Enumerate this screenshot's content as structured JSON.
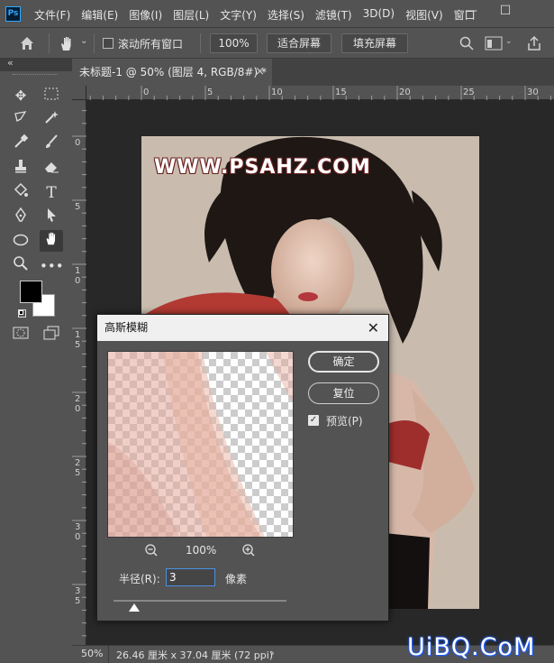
{
  "app": {
    "logo_text": "Ps"
  },
  "menu": [
    "文件(F)",
    "编辑(E)",
    "图像(I)",
    "图层(L)",
    "文字(Y)",
    "选择(S)",
    "滤镜(T)",
    "3D(D)",
    "视图(V)",
    "窗口"
  ],
  "window_controls": {
    "minimize": "—",
    "maximize": "☐"
  },
  "options": {
    "scroll_all_label": "滚动所有窗口",
    "zoom_value": "100%",
    "fit_screen": "适合屏幕",
    "fill_screen": "填充屏幕"
  },
  "toolbox": {
    "collapse": "«"
  },
  "document": {
    "tab_title": "未标题-1 @ 50% (图层 4, RGB/8#) *",
    "tab_close": "×"
  },
  "rulers": {
    "h": [
      "0",
      "5",
      "10",
      "15",
      "20",
      "25",
      "30"
    ],
    "v": [
      [
        "0"
      ],
      [
        "5"
      ],
      [
        "1",
        "0"
      ],
      [
        "1",
        "5"
      ],
      [
        "2",
        "0"
      ],
      [
        "2",
        "5"
      ],
      [
        "3",
        "0"
      ],
      [
        "3",
        "5"
      ]
    ]
  },
  "image_text": "WWW.PSAHZ.COM",
  "dialog": {
    "title": "高斯模糊",
    "close": "✕",
    "ok": "确定",
    "reset": "复位",
    "preview_label": "预览(P)",
    "preview_checked": true,
    "zoom_out": "⊖",
    "zoom_in": "⊕",
    "zoom_level": "100%",
    "radius_label": "半径(R):",
    "radius_value": "3",
    "radius_unit": "像素",
    "radius_slider_fraction": 0.12
  },
  "status": {
    "zoom": "50%",
    "doc_info": "26.46 厘米 x 37.04 厘米 (72 ppi)",
    "arrow": "›"
  },
  "watermark": "UiBQ.CoM",
  "colors": {
    "foreground": "#000000",
    "background": "#ffffff",
    "accent": "#31a8ff"
  }
}
